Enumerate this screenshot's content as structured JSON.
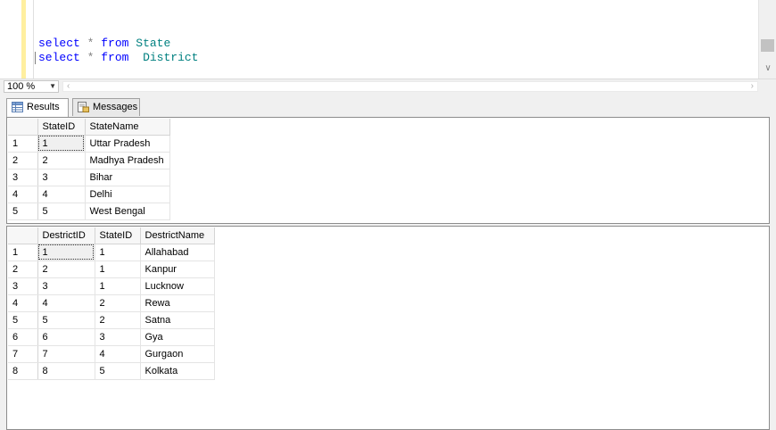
{
  "editor": {
    "line1": {
      "kw1": "select",
      "star": "*",
      "kw2": "from",
      "ident": "State"
    },
    "line2": {
      "kw1": "select",
      "star": "*",
      "kw2": "from",
      "ident": "District"
    }
  },
  "zoombar": {
    "zoom_value": "100 %"
  },
  "tabs": {
    "results_label": "Results",
    "messages_label": "Messages"
  },
  "grid1": {
    "headers": [
      "StateID",
      "StateName"
    ],
    "rows": [
      {
        "n": "1",
        "id": "1",
        "name": "Uttar Pradesh"
      },
      {
        "n": "2",
        "id": "2",
        "name": "Madhya Pradesh"
      },
      {
        "n": "3",
        "id": "3",
        "name": "Bihar"
      },
      {
        "n": "4",
        "id": "4",
        "name": "Delhi"
      },
      {
        "n": "5",
        "id": "5",
        "name": "West Bengal"
      }
    ]
  },
  "grid2": {
    "headers": [
      "DestrictID",
      "StateID",
      "DestrictName"
    ],
    "rows": [
      {
        "n": "1",
        "id": "1",
        "state": "1",
        "name": "Allahabad"
      },
      {
        "n": "2",
        "id": "2",
        "state": "1",
        "name": "Kanpur"
      },
      {
        "n": "3",
        "id": "3",
        "state": "1",
        "name": "Lucknow"
      },
      {
        "n": "4",
        "id": "4",
        "state": "2",
        "name": "Rewa"
      },
      {
        "n": "5",
        "id": "5",
        "state": "2",
        "name": "Satna"
      },
      {
        "n": "6",
        "id": "6",
        "state": "3",
        "name": "Gya"
      },
      {
        "n": "7",
        "id": "7",
        "state": "4",
        "name": "Gurgaon"
      },
      {
        "n": "8",
        "id": "8",
        "state": "5",
        "name": "Kolkata"
      }
    ]
  }
}
